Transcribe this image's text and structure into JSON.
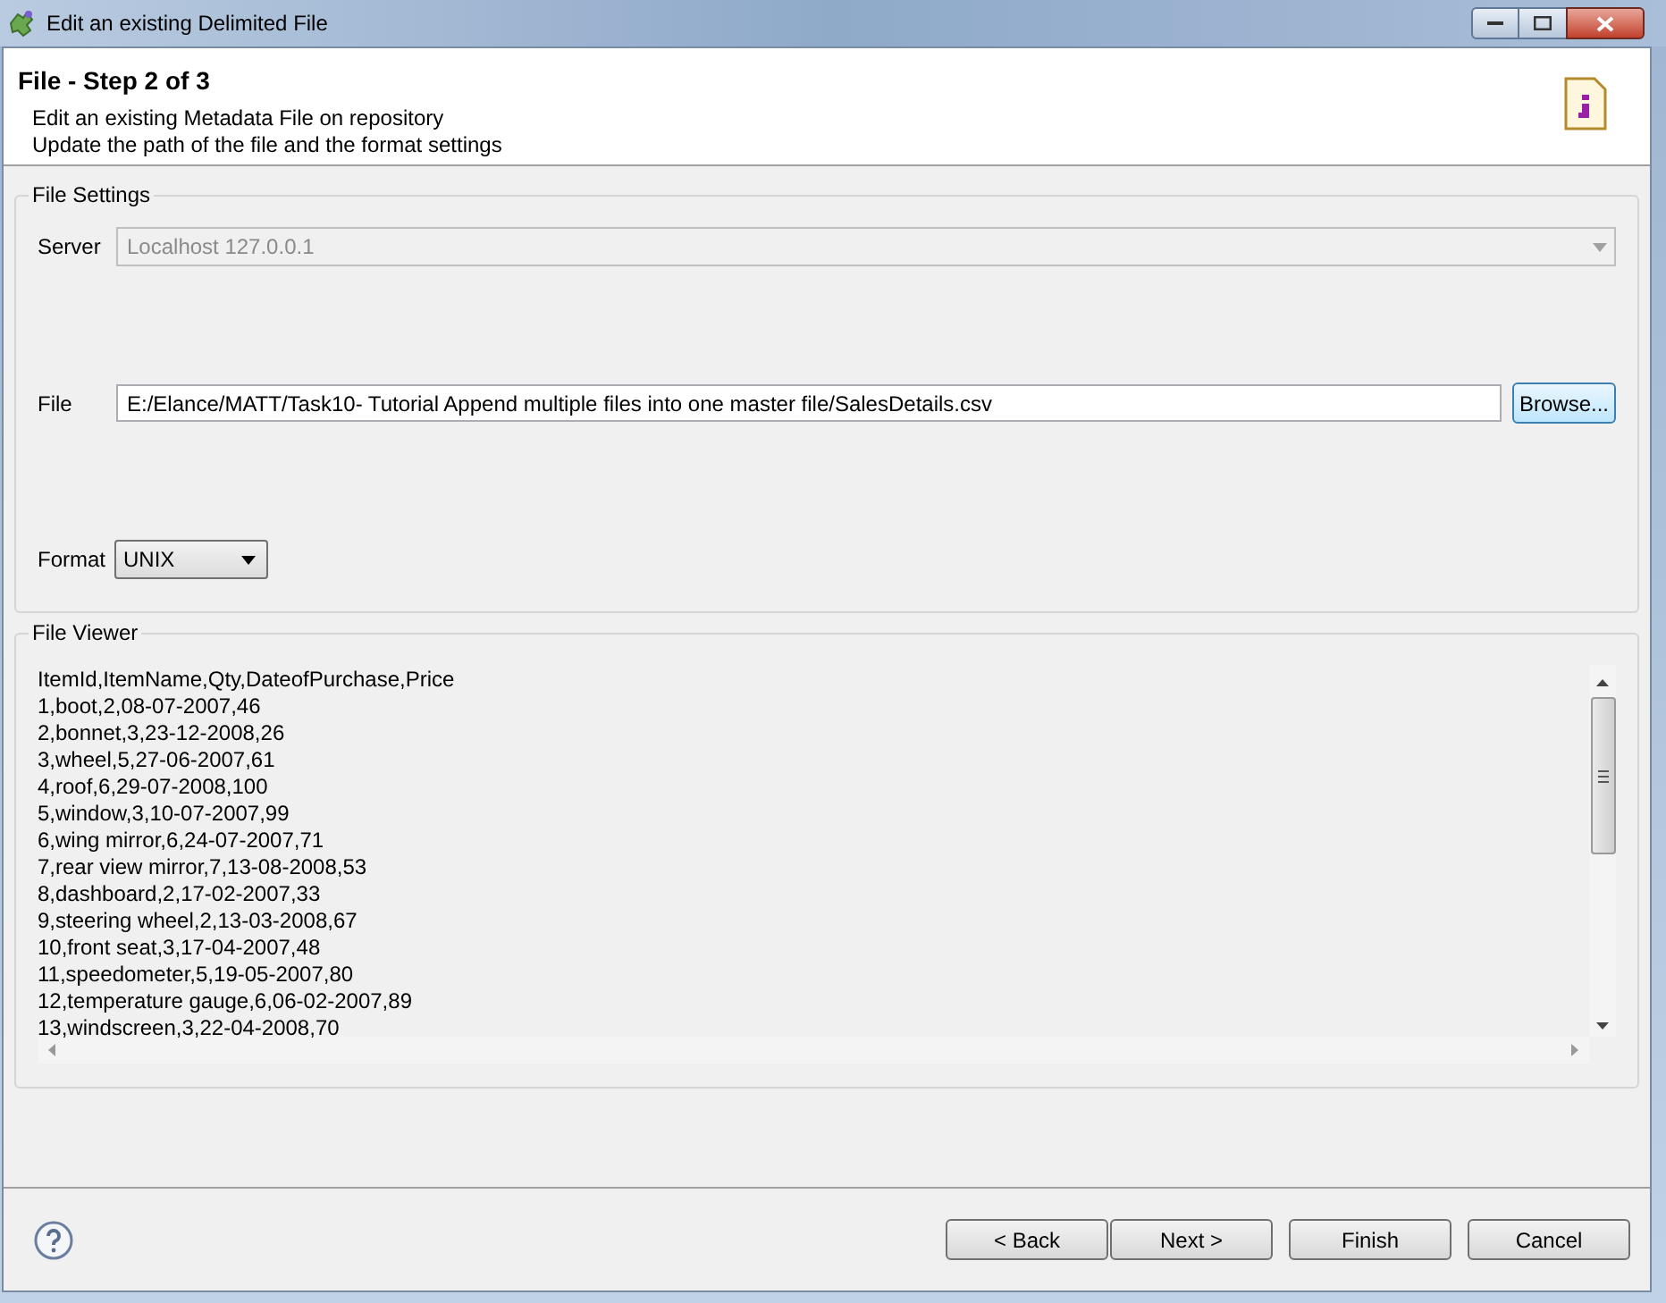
{
  "window": {
    "title": "Edit an existing Delimited File"
  },
  "header": {
    "title": "File - Step 2 of 3",
    "lines": [
      "Edit an existing Metadata File on repository",
      "Update the path of the file and the format settings"
    ]
  },
  "file_settings": {
    "title": "File Settings",
    "server": {
      "label": "Server",
      "value": "Localhost 127.0.0.1",
      "disabled": true
    },
    "file": {
      "label": "File",
      "value": "E:/Elance/MATT/Task10- Tutorial Append multiple files into one master file/SalesDetails.csv",
      "browse": "Browse..."
    },
    "format": {
      "label": "Format",
      "value": "UNIX"
    }
  },
  "file_viewer": {
    "title": "File Viewer",
    "lines": [
      "ItemId,ItemName,Qty,DateofPurchase,Price",
      "1,boot,2,08-07-2007,46",
      "2,bonnet,3,23-12-2008,26",
      "3,wheel,5,27-06-2007,61",
      "4,roof,6,29-07-2008,100",
      "5,window,3,10-07-2007,99",
      "6,wing mirror,6,24-07-2007,71",
      "7,rear view mirror,7,13-08-2008,53",
      "8,dashboard,2,17-02-2007,33",
      "9,steering wheel,2,13-03-2008,67",
      "10,front seat,3,17-04-2007,48",
      "11,speedometer,5,19-05-2007,80",
      "12,temperature gauge,6,06-02-2007,89",
      "13,windscreen,3,22-04-2008,70"
    ]
  },
  "buttons": [
    {
      "label": "< Back",
      "focused": false
    },
    {
      "label": "Next >",
      "focused": false
    },
    {
      "label": "Finish",
      "focused": false
    },
    {
      "label": "Cancel",
      "focused": false
    }
  ]
}
